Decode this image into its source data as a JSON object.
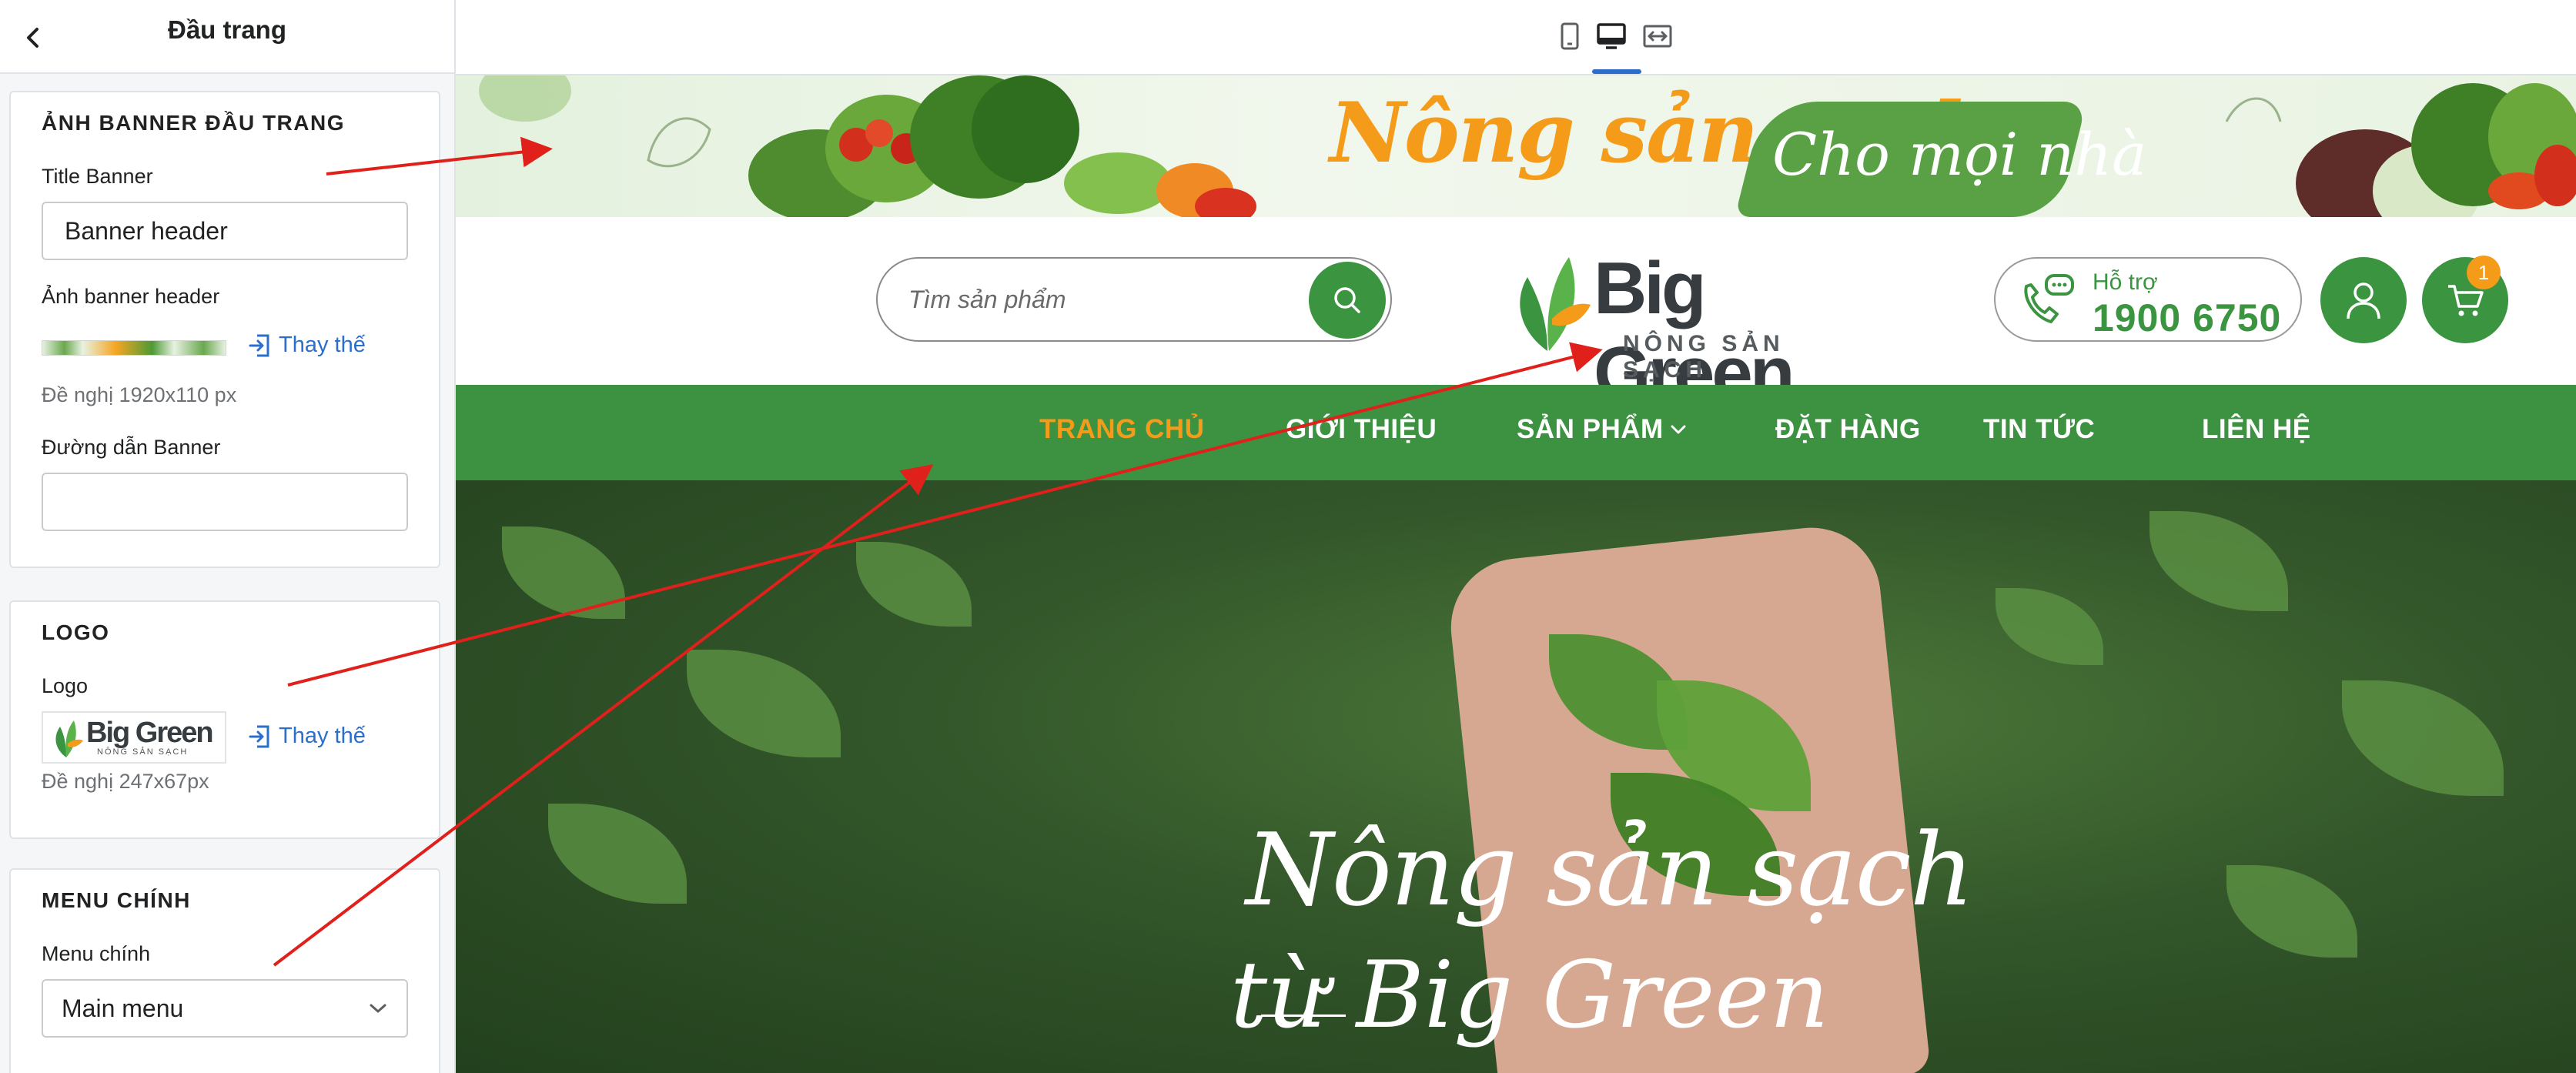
{
  "sidebar": {
    "title": "Đầu trang",
    "banner_section": {
      "title": "ẢNH BANNER ĐẦU TRANG",
      "title_banner_label": "Title Banner",
      "title_banner_value": "Banner header",
      "image_label": "Ảnh banner header",
      "replace_label": "Thay thế",
      "hint": "Đề nghị 1920x110 px",
      "link_label": "Đường dẫn Banner",
      "link_value": ""
    },
    "logo_section": {
      "title": "LOGO",
      "logo_label": "Logo",
      "replace_label": "Thay thế",
      "hint": "Đề nghị 247x67px",
      "thumb_text": "Big Green",
      "thumb_sub": "NÔNG SẢN SẠCH"
    },
    "menu_section": {
      "title": "MENU CHÍNH",
      "menu_label": "Menu chính",
      "menu_value": "Main menu"
    }
  },
  "preview": {
    "banner": {
      "title": "Nông sản sạch",
      "subtitle": "Cho mọi nhà"
    },
    "search": {
      "placeholder": "Tìm sản phẩm"
    },
    "logo": {
      "text": "Big Green",
      "sub": "NÔNG SẢN SẠCH"
    },
    "support": {
      "label": "Hỗ trợ",
      "phone": "1900 6750"
    },
    "cart_count": "1",
    "nav": [
      {
        "label": "TRANG CHỦ",
        "active": true
      },
      {
        "label": "GIỚI THIỆU"
      },
      {
        "label": "SẢN PHẨM",
        "has_dropdown": true
      },
      {
        "label": "ĐẶT HÀNG"
      },
      {
        "label": "TIN TỨC"
      },
      {
        "label": "LIÊN HỆ"
      }
    ],
    "hero": {
      "line1": "Nông sản sạch",
      "line2": "từ Big Green"
    }
  },
  "colors": {
    "brand_green": "#3c9241",
    "accent_orange": "#f59b1a",
    "link_blue": "#2c6ecb",
    "annotation_red": "#e0201b"
  }
}
